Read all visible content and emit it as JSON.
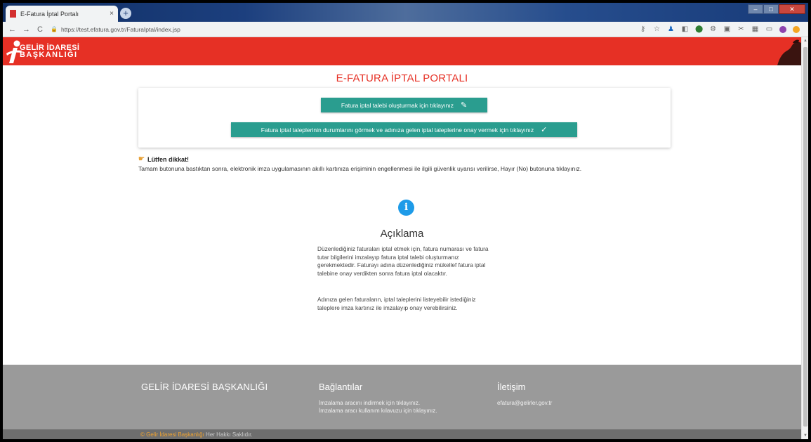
{
  "browser": {
    "tab_title": "E-Fatura İptal Portalı",
    "tab_close": "×",
    "new_tab": "+",
    "url": "https://test.efatura.gov.tr/FaturaIptal/index.jsp",
    "win_min": "–",
    "win_max": "□",
    "win_close": "✕"
  },
  "header": {
    "logo_line1": "GELİR İDARESİ",
    "logo_line2": "BAŞKANLIĞI"
  },
  "main": {
    "page_title": "E-FATURA İPTAL PORTALI",
    "button_create": "Fatura iptal talebi oluşturmak için tıklayınız",
    "button_status": "Fatura iptal taleplerinin durumlarını görmek ve adınıza gelen iptal taleplerine onay vermek için tıklayınız",
    "notice_title": "Lütfen dikkat!",
    "notice_text": "Tamam butonuna bastıktan sonra, elektronik imza uygulamasının akıllı kartınıza erişiminin engellenmesi ile ilgili güvenlik uyarısı verilirse, Hayır (No) butonuna tıklayınız.",
    "info_title": "Açıklama",
    "info_p1": "Düzenlediğiniz faturaları iptal etmek için, fatura numarası ve fatura tutar bilgilerini imzalayıp fatura iptal talebi oluşturmanız gerekmektedir. Faturayı adına düzenlediğiniz mükellef fatura iptal talebine onay verdikten sonra fatura iptal olacaktır.",
    "info_p2": "Adınıza gelen faturaların, iptal taleplerini listeyebilir istediğiniz taleplere imza kartınız ile imzalayıp onay verebilirsiniz."
  },
  "footer": {
    "org_name": "GELİR İDARESİ BAŞKANLIĞI",
    "links_title": "Bağlantılar",
    "link1": "İmzalama aracını indirmek için tıklayınız.",
    "link2": "İmzalama aracı kullanım kılavuzu için tıklayınız.",
    "contact_title": "İletişim",
    "contact_email": "efatura@gelirler.gov.tr",
    "bottom_copyright": "© Gelir İdaresi Başkanlığı",
    "bottom_rights": " Her Hakkı Saklıdır."
  },
  "colors": {
    "brand_red": "#e63025",
    "button_teal": "#2a9d8f",
    "info_blue": "#1e9be8",
    "footer_gray": "#9a9a9a"
  },
  "icons": {
    "pencil": "pencil-icon",
    "check": "check-icon",
    "info": "info-icon",
    "hand": "pointing-hand-icon"
  }
}
